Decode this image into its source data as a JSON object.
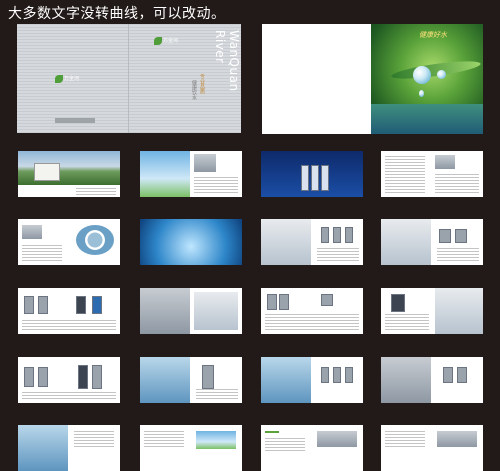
{
  "caption": "大多数文字没转曲线，可以改动。",
  "cover": {
    "brand": "WanQuan River",
    "logo_text": "万全河",
    "vertical_cn_1": "专业品质",
    "vertical_cn_2": "健康饮水"
  },
  "feature_spread": {
    "headline": "健康好水"
  },
  "thumbnail_spreads": 20,
  "colors": {
    "background": "#221a19",
    "brand_green": "#4f9e3a",
    "cover_grey": "#cfd3d7",
    "caption": "#ffffff"
  }
}
